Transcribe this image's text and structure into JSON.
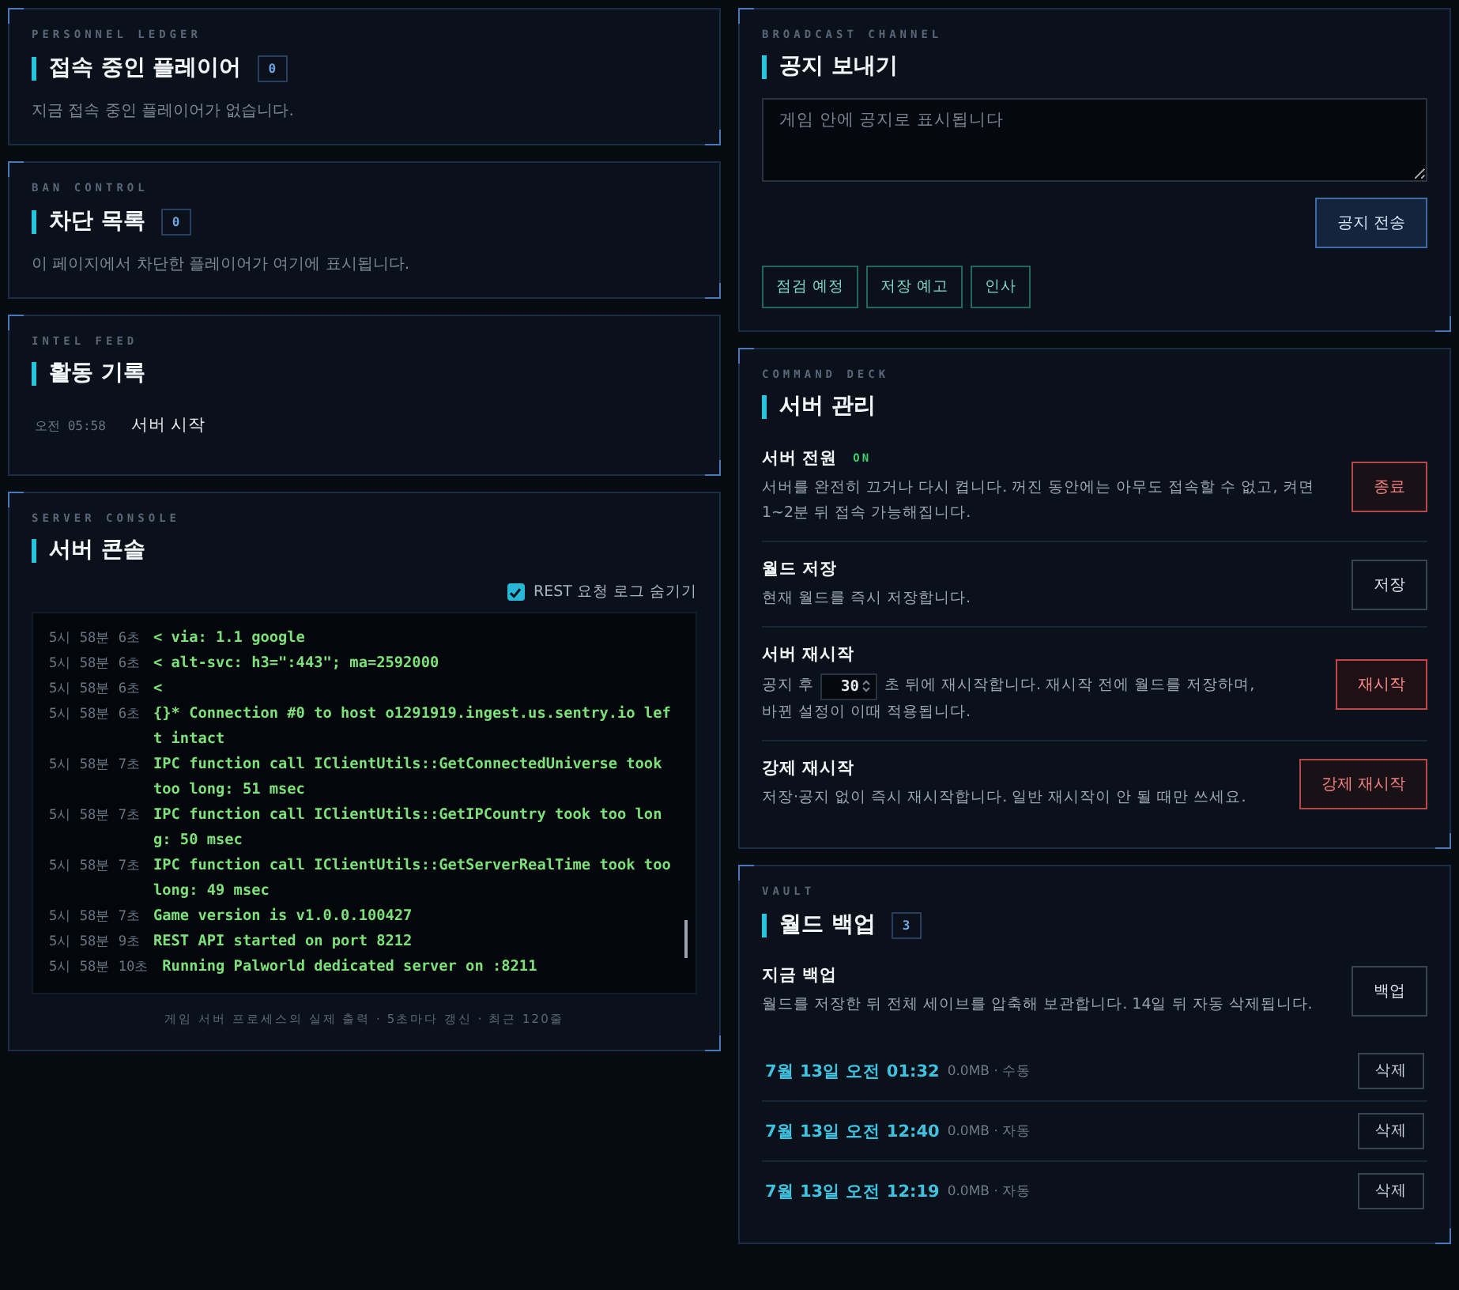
{
  "left": [
    {
      "kind": "players",
      "eyebrow": "PERSONNEL LEDGER",
      "title": "접속 중인 플레이어",
      "count": "0",
      "empty": "지금 접속 중인 플레이어가 없습니다."
    },
    {
      "kind": "bans",
      "eyebrow": "BAN CONTROL",
      "title": "차단 목록",
      "count": "0",
      "empty": "이 페이지에서 차단한 플레이어가 여기에 표시됩니다."
    },
    {
      "kind": "activity",
      "eyebrow": "INTEL FEED",
      "title": "활동 기록",
      "entries": [
        {
          "time": "오전 05:58",
          "text": "서버 시작"
        }
      ]
    },
    {
      "kind": "console",
      "eyebrow": "SERVER CONSOLE",
      "title": "서버 콘솔",
      "filter": {
        "label": "REST 요청 로그 숨기기",
        "checked": true
      },
      "lines": [
        {
          "time": "5시 58분 6초",
          "text": "< via: 1.1 google"
        },
        {
          "time": "5시 58분 6초",
          "text": "< alt-svc: h3=\":443\"; ma=2592000"
        },
        {
          "time": "5시 58분 6초",
          "text": "<"
        },
        {
          "time": "5시 58분 6초",
          "text": "{}* Connection #0 to host o1291919.ingest.us.sentry.io left intact"
        },
        {
          "time": "5시 58분 7초",
          "text": "IPC function call IClientUtils::GetConnectedUniverse took too long: 51 msec"
        },
        {
          "time": "5시 58분 7초",
          "text": "IPC function call IClientUtils::GetIPCountry took too long: 50 msec"
        },
        {
          "time": "5시 58분 7초",
          "text": "IPC function call IClientUtils::GetServerRealTime took too long: 49 msec"
        },
        {
          "time": "5시 58분 7초",
          "text": "Game version is v1.0.0.100427"
        },
        {
          "time": "5시 58분 9초",
          "text": "REST API started on port 8212"
        },
        {
          "time": "5시 58분 10초",
          "text": " Running Palworld dedicated server on :8211"
        }
      ],
      "footer": "게임 서버 프로세스의 실제 출력 · 5초마다 갱신 · 최근 120줄"
    }
  ],
  "right": [
    {
      "kind": "broadcast",
      "eyebrow": "BROADCAST CHANNEL",
      "title": "공지 보내기",
      "message": {
        "placeholder": "게임 안에 공지로 표시됩니다"
      },
      "send": "공지 전송",
      "presets": [
        "점검 예정",
        "저장 예고",
        "인사"
      ]
    },
    {
      "kind": "commands",
      "eyebrow": "COMMAND DECK",
      "title": "서버 관리",
      "rows": [
        {
          "kind": "power",
          "title": "서버 전원",
          "status": "ON",
          "desc": "서버를 완전히 끄거나 다시 켭니다. 꺼진 동안에는 아무도 접속할 수 없고, 켜면 1~2분 뒤 접속 가능해집니다.",
          "button": {
            "label": "종료",
            "kind": "danger"
          }
        },
        {
          "kind": "plain",
          "title": "월드 저장",
          "desc": "현재 월드를 즉시 저장합니다.",
          "button": {
            "label": "저장",
            "kind": "neutral"
          }
        },
        {
          "kind": "restart",
          "title": "서버 재시작",
          "before": "공지 후",
          "seconds": "30",
          "after": "초 뒤에 재시작합니다. 재시작 전에 월드를 저장하며,",
          "desc": "바뀐 설정이 이때 적용됩니다.",
          "button": {
            "label": "재시작",
            "kind": "alert"
          }
        },
        {
          "kind": "plain",
          "title": "강제 재시작",
          "desc": "저장·공지 없이 즉시 재시작합니다. 일반 재시작이 안 될 때만 쓰세요.",
          "button": {
            "label": "강제 재시작",
            "kind": "danger"
          }
        }
      ]
    },
    {
      "kind": "backups",
      "eyebrow": "VAULT",
      "title": "월드 백업",
      "count": "3",
      "now": {
        "title": "지금 백업",
        "desc": "월드를 저장한 뒤 전체 세이브를 압축해 보관합니다. 14일 뒤 자동 삭제됩니다.",
        "button": "백업"
      },
      "items": [
        {
          "date": "7월 13일 오전 01:32",
          "meta": "0.0MB · 수동",
          "button": "삭제"
        },
        {
          "date": "7월 13일 오전 12:40",
          "meta": "0.0MB · 자동",
          "button": "삭제"
        },
        {
          "date": "7월 13일 오전 12:19",
          "meta": "0.0MB · 자동",
          "button": "삭제"
        }
      ]
    }
  ]
}
